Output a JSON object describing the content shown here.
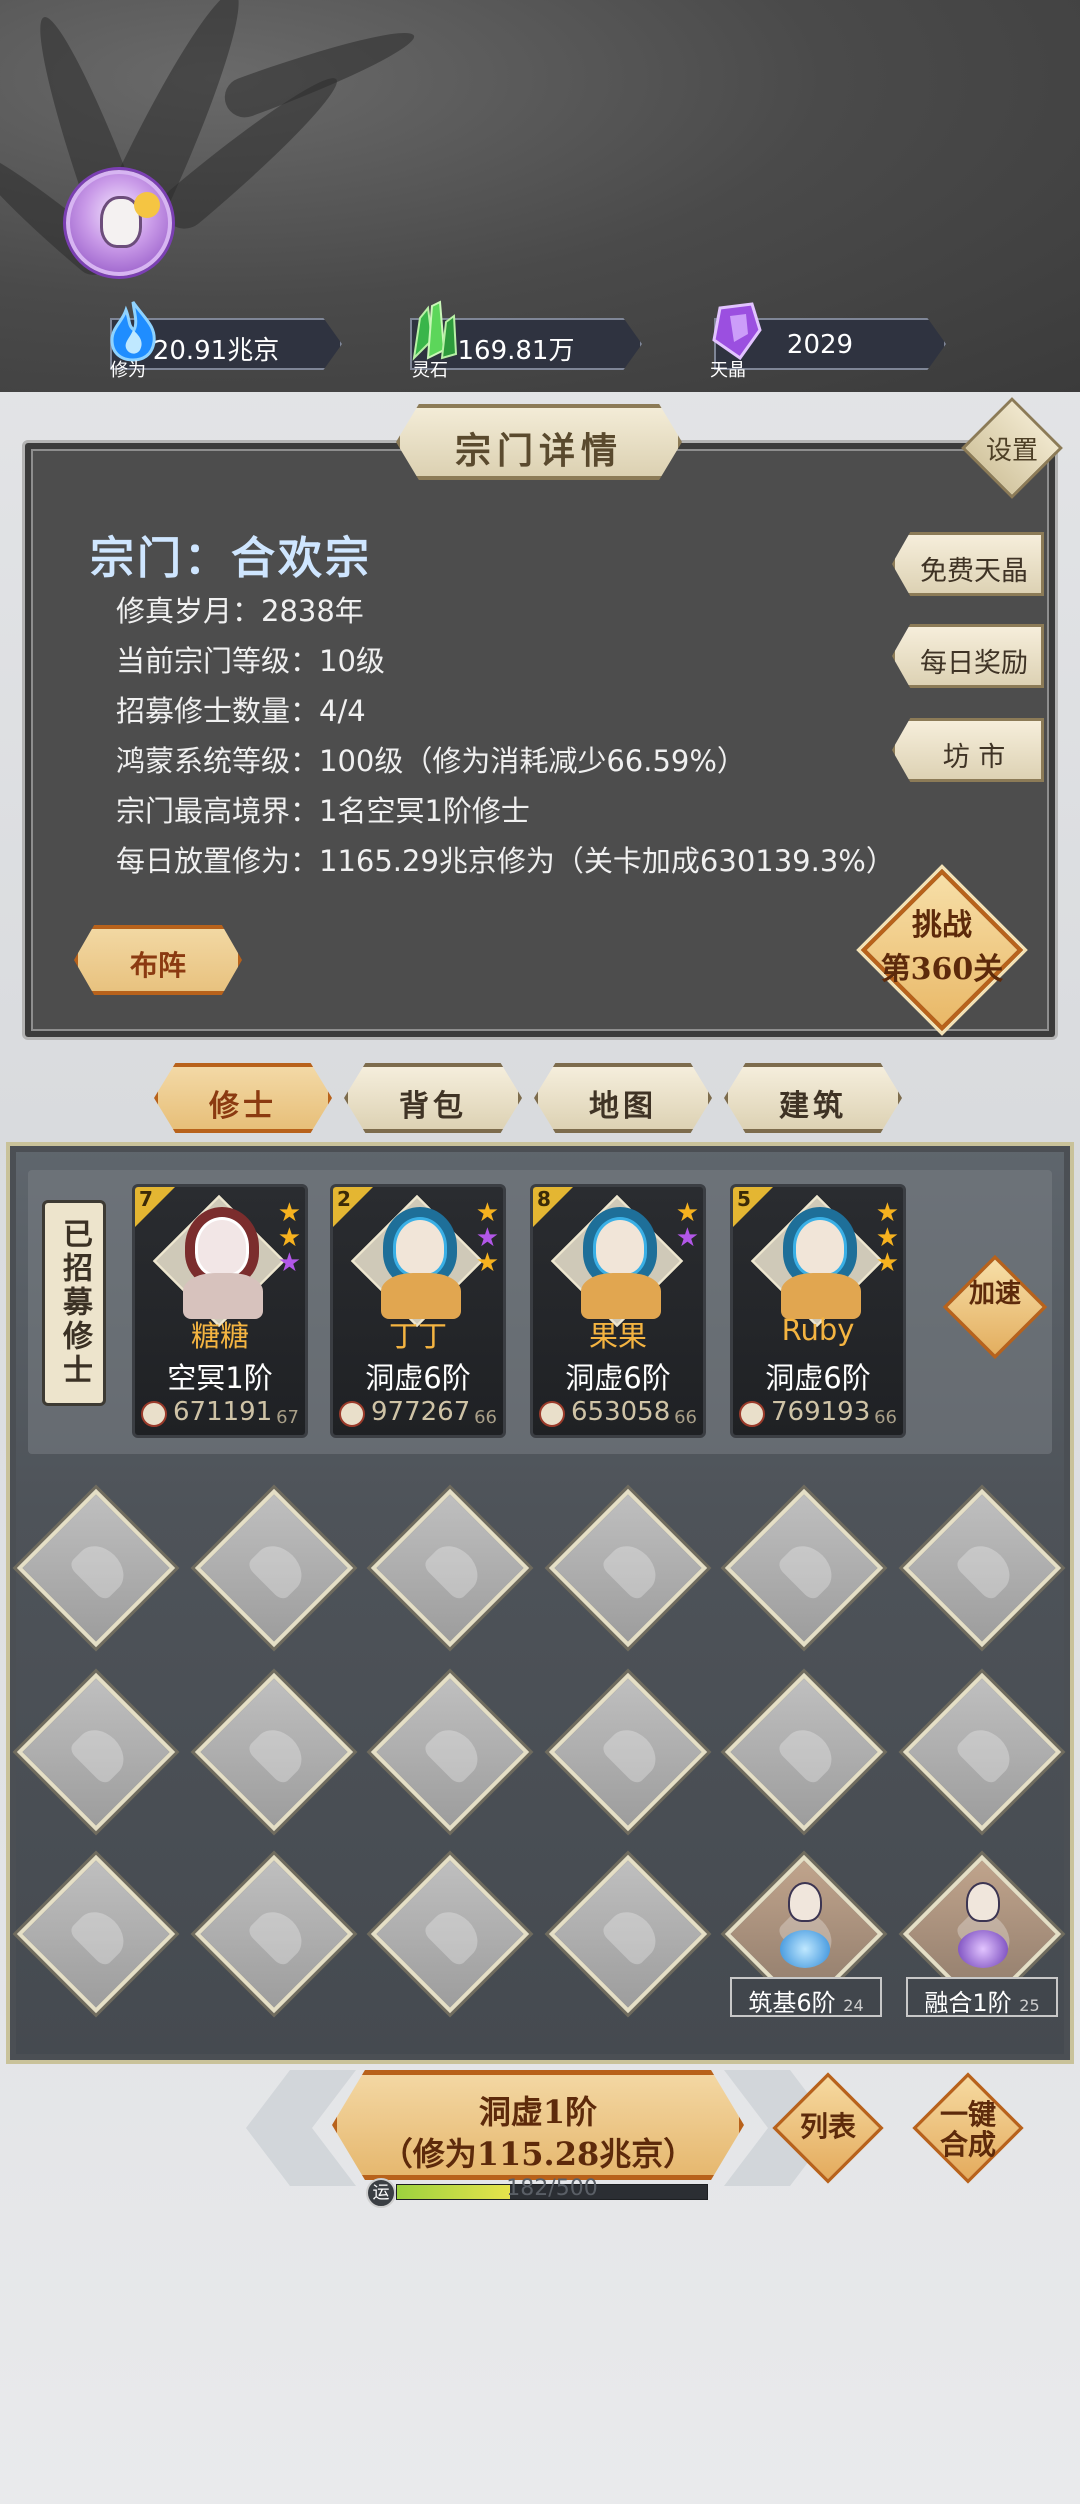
{
  "resources": [
    {
      "name": "修为",
      "value": "20.91兆京",
      "icon": "blue-flame-icon",
      "color": "#3aa6ff"
    },
    {
      "name": "灵石",
      "value": "169.81万",
      "icon": "green-crystal-icon",
      "color": "#4fc45b"
    },
    {
      "name": "天晶",
      "value": "2029",
      "icon": "purple-crystal-icon",
      "color": "#a45be6"
    }
  ],
  "panel": {
    "title": "宗门详情",
    "settings_label": "设置",
    "sect_name": "宗门：合欢宗",
    "info": [
      "修真岁月：2838年",
      "当前宗门等级：10级",
      "招募修士数量：4/4",
      "鸿蒙系统等级：100级（修为消耗减少66.59%）",
      "宗门最高境界：1名空冥1阶修士",
      "每日放置修为：1165.29兆京修为（关卡加成630139.3%）"
    ],
    "side_buttons": [
      "免费天晶",
      "每日奖励",
      "坊 市"
    ],
    "formation_label": "布阵",
    "challenge_line1": "挑战",
    "challenge_line2": "第360关"
  },
  "tabs": [
    "修士",
    "背包",
    "地图",
    "建筑"
  ],
  "active_tab": 0,
  "recruited_label": "已招募修士",
  "heroes": [
    {
      "level": "7",
      "name": "糖糖",
      "realm": "空冥1阶",
      "power": "671191",
      "power_sub": "67",
      "stars": [
        "gold",
        "gold",
        "purple"
      ],
      "theme": "pink"
    },
    {
      "level": "2",
      "name": "丁丁",
      "realm": "洞虚6阶",
      "power": "977267",
      "power_sub": "66",
      "stars": [
        "gold",
        "purple",
        "gold"
      ],
      "theme": "blue"
    },
    {
      "level": "8",
      "name": "果果",
      "realm": "洞虚6阶",
      "power": "653058",
      "power_sub": "66",
      "stars": [
        "gold",
        "purple"
      ],
      "theme": "blue"
    },
    {
      "level": "5",
      "name": "Ruby",
      "realm": "洞虚6阶",
      "power": "769193",
      "power_sub": "66",
      "stars": [
        "gold",
        "gold",
        "gold"
      ],
      "theme": "blue"
    }
  ],
  "speed_label": "加速",
  "slot_tags": [
    {
      "label": "筑基6阶",
      "sub": "24"
    },
    {
      "label": "融合1阶",
      "sub": "25"
    }
  ],
  "bottom": {
    "upgrade_line1": "洞虚1阶",
    "upgrade_line2": "（修为115.28兆京）",
    "list_label": "列表",
    "merge_label": "一键合成",
    "luck_label": "运",
    "luck_progress": "182/500",
    "luck_value": 182,
    "luck_max": 500
  }
}
